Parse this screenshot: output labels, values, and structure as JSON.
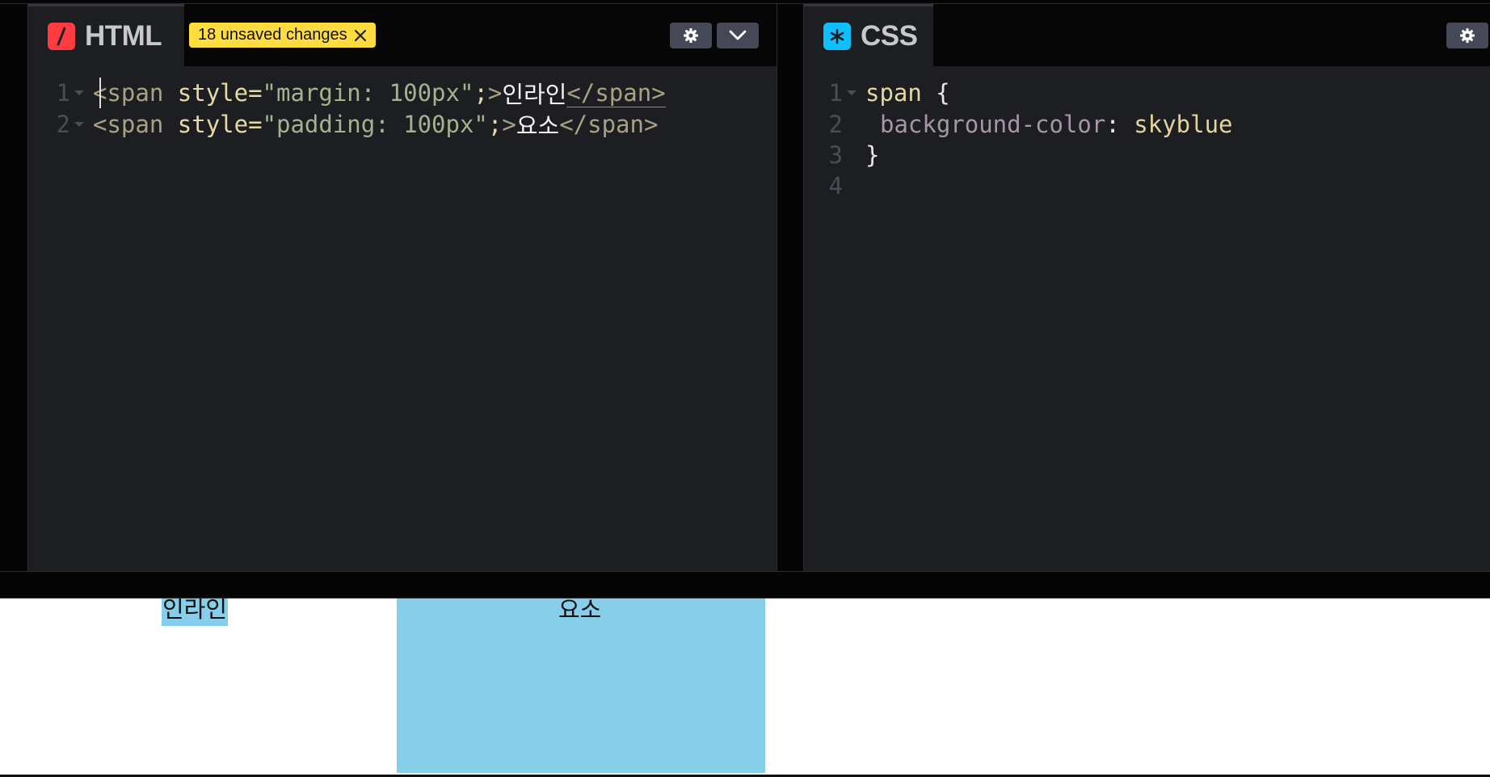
{
  "html_panel": {
    "title": "HTML",
    "unsaved_label": "18 unsaved changes",
    "lines": [
      {
        "num": "1",
        "tag_open": "<span",
        "attr": " style=",
        "str": "\"margin: 100px\"",
        "semi": ";",
        "gt": ">",
        "text": "인라인",
        "tag_close": "</span>"
      },
      {
        "num": "2",
        "tag_open": "<span",
        "attr": " style=",
        "str": "\"padding: 100px\"",
        "semi": ";",
        "gt": ">",
        "text": "요소",
        "tag_close": "</span>"
      }
    ]
  },
  "css_panel": {
    "title": "CSS",
    "lines": [
      {
        "num": "1",
        "selector": "span",
        "brace": " {"
      },
      {
        "num": "2",
        "prop": "background-color",
        "colon": ": ",
        "value": "skyblue"
      },
      {
        "num": "3",
        "brace": "}"
      },
      {
        "num": "4"
      }
    ]
  },
  "preview": {
    "span1_text": "인라인",
    "span2_text": "요소"
  },
  "colors": {
    "html_icon": "#ff3c41",
    "css_icon": "#0ebeff",
    "unsaved_badge": "#ffdd40",
    "skyblue": "#87ceeb"
  },
  "icons": {
    "html_tab": "html-slash-icon",
    "css_tab": "css-asterisk-icon",
    "settings": "gear-icon",
    "collapse": "chevron-down-icon",
    "close_unsaved": "close-icon"
  }
}
